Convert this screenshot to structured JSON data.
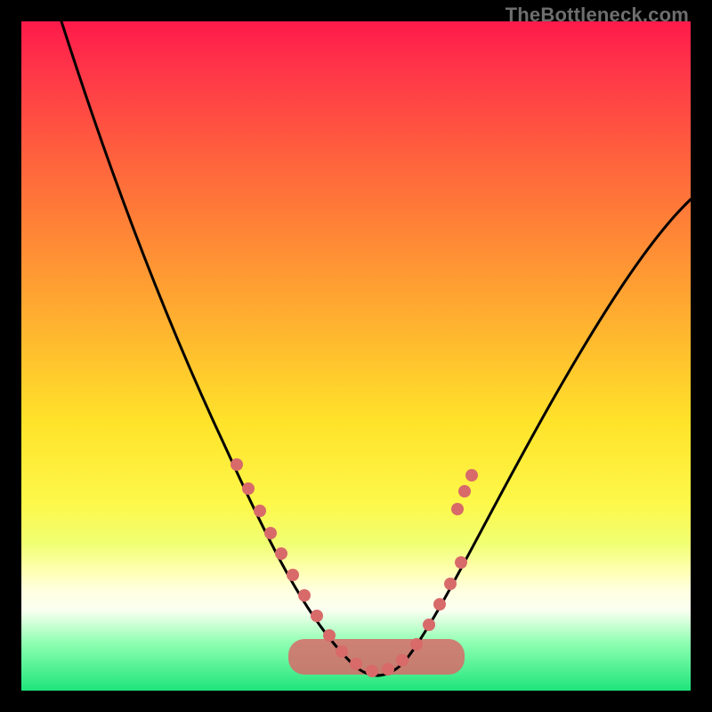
{
  "watermark": "TheBottleneck.com",
  "chart_data": {
    "type": "line",
    "title": "",
    "xlabel": "",
    "ylabel": "",
    "xlim": [
      0,
      100
    ],
    "ylim": [
      0,
      100
    ],
    "series": [
      {
        "name": "bottleneck-curve",
        "x": [
          6,
          10,
          14,
          18,
          22,
          26,
          30,
          34,
          38,
          42,
          44,
          46,
          48,
          50,
          52,
          54,
          56,
          60,
          64,
          68,
          72,
          76,
          80,
          84,
          88,
          92,
          96,
          100
        ],
        "values": [
          100,
          88,
          76,
          65,
          55,
          46,
          37,
          29,
          22,
          14,
          11,
          8,
          5,
          2,
          0,
          0,
          2,
          6,
          11,
          17,
          23,
          29,
          35,
          41,
          47,
          52,
          57,
          62
        ]
      }
    ],
    "markers": {
      "name": "highlight-dots",
      "color": "#d86a6a",
      "x": [
        27,
        29,
        31,
        33,
        35,
        37,
        39,
        41,
        43,
        45,
        47,
        49,
        51,
        53,
        55,
        57,
        59,
        61,
        63,
        65,
        67
      ],
      "values": [
        44,
        40,
        36,
        32,
        28,
        24,
        20,
        16,
        12,
        8,
        5,
        2,
        1,
        1,
        2,
        5,
        8,
        12,
        16,
        20,
        24
      ]
    },
    "band": {
      "name": "marker-band",
      "color": "#d86a6a",
      "y0": 0,
      "y1": 6,
      "x0": 40,
      "x1": 66
    }
  }
}
